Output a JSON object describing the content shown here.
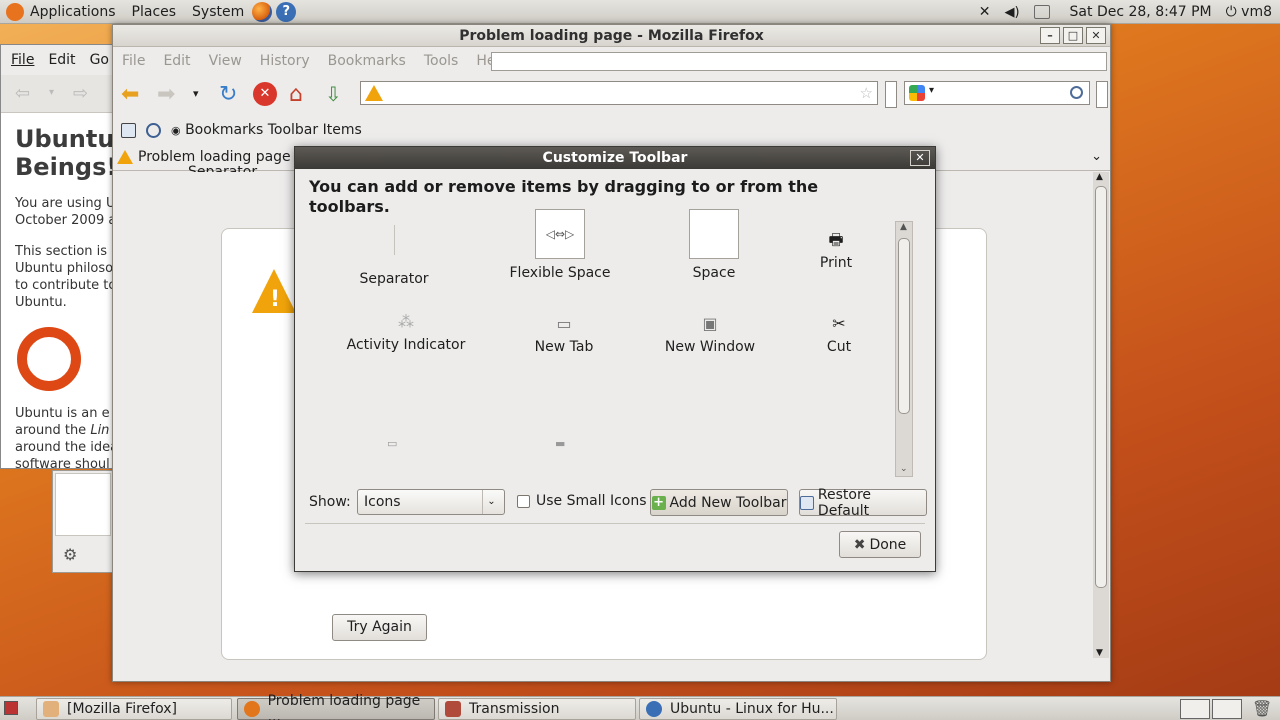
{
  "top_panel": {
    "menus": [
      "Applications",
      "Places",
      "System"
    ],
    "clock": "Sat Dec 28,  8:47 PM",
    "user": "vm8"
  },
  "bg_window": {
    "menus": [
      "File",
      "Edit",
      "Go"
    ],
    "heading_line1": "Ubuntu",
    "heading_line2": "Beings!",
    "para1": "You are using U October 2009 a",
    "para2": "This section is Ubuntu philoso to contribute to Ubuntu.",
    "para3_a": "Ubuntu is an e around the",
    "para3_em": "Lin",
    "para3_b": "around the idea software shoul"
  },
  "firefox": {
    "title": "Problem loading page - Mozilla Firefox",
    "menus": [
      "File",
      "Edit",
      "View",
      "History",
      "Bookmarks",
      "Tools",
      "Help"
    ],
    "bookmarks_item": "Bookmarks Toolbar Items",
    "tab_label": "Problem loading page",
    "tab_drag_label": "Separator",
    "try_again": "Try Again"
  },
  "dialog": {
    "title": "Customize Toolbar",
    "message": "You can add or remove items by dragging to or from the toolbars.",
    "items": [
      {
        "label": "Separator",
        "icon": "separator-icon"
      },
      {
        "label": "Flexible Space",
        "icon": "flexible-space-icon",
        "glyph": "◁⇔▷"
      },
      {
        "label": "Space",
        "icon": "space-icon"
      },
      {
        "label": "Print",
        "icon": "printer-icon"
      },
      {
        "label": "Activity Indicator",
        "icon": "throbber-icon"
      },
      {
        "label": "New Tab",
        "icon": "new-tab-icon"
      },
      {
        "label": "New Window",
        "icon": "new-window-icon"
      },
      {
        "label": "Cut",
        "icon": "scissors-icon"
      }
    ],
    "show_label": "Show:",
    "show_value": "Icons",
    "small_icons_label": "Use Small Icons",
    "add_toolbar": "Add New Toolbar",
    "restore_default": "Restore Default",
    "done": "Done"
  },
  "taskbar": {
    "items": [
      "[Mozilla Firefox]",
      "Problem loading page ...",
      "Transmission",
      "Ubuntu - Linux for Hu..."
    ]
  },
  "colors": {
    "warning": "#f0a30a",
    "ubuntu_orange": "#dd4814",
    "dialog_title_bg": "#3c3a36"
  }
}
